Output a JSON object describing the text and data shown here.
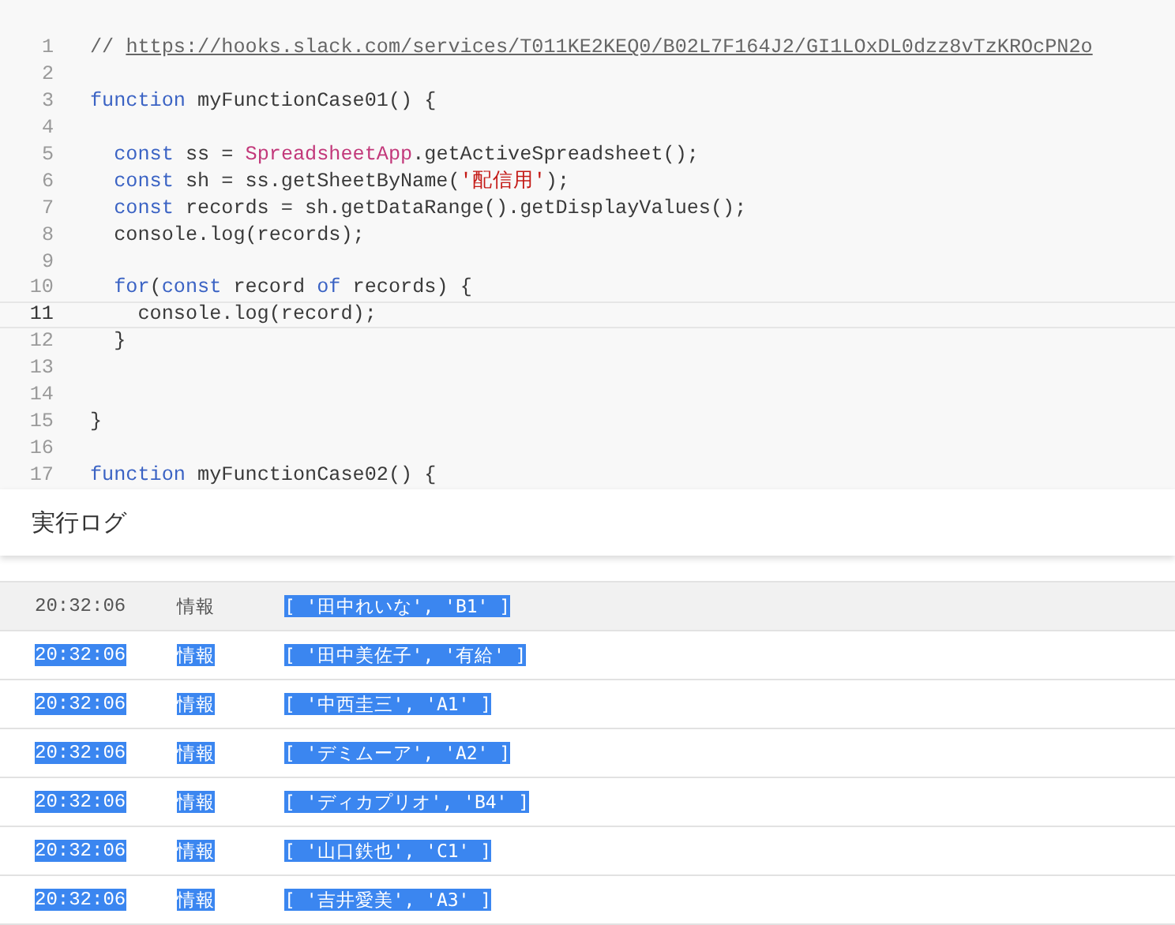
{
  "editor": {
    "lines": [
      {
        "number": "1",
        "current": false,
        "tokens": [
          {
            "kind": "comment",
            "text": "// "
          },
          {
            "kind": "link",
            "text": "https://hooks.slack.com/services/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"
          }
        ]
      },
      {
        "number": "2",
        "current": false
      },
      {
        "number": "3",
        "current": false,
        "tokens": [
          {
            "kind": "keyword",
            "text": "function"
          },
          {
            "kind": "plain",
            "text": " myFunctionCase01() {"
          }
        ]
      },
      {
        "number": "4",
        "current": false
      },
      {
        "number": "5",
        "current": false,
        "tokens": [
          {
            "kind": "keyword",
            "text": "  const"
          },
          {
            "kind": "plain",
            "text": " ss = "
          },
          {
            "kind": "class",
            "text": "SpreadsheetApp"
          },
          {
            "kind": "plain",
            "text": ".getActiveSpreadsheet();"
          }
        ]
      },
      {
        "number": "6",
        "current": false,
        "tokens": [
          {
            "kind": "keyword",
            "text": "  const"
          },
          {
            "kind": "plain",
            "text": " sh = ss.getSheetByName("
          },
          {
            "kind": "string",
            "text": "'配信用'"
          },
          {
            "kind": "plain",
            "text": ");"
          }
        ]
      },
      {
        "number": "7",
        "current": false,
        "tokens": [
          {
            "kind": "keyword",
            "text": "  const"
          },
          {
            "kind": "plain",
            "text": " records = sh.getDataRange().getDisplayValues();"
          }
        ]
      },
      {
        "number": "8",
        "current": false,
        "tokens": [
          {
            "kind": "plain",
            "text": "  console.log(records);"
          }
        ]
      },
      {
        "number": "9",
        "current": false
      },
      {
        "number": "10",
        "current": false,
        "tokens": [
          {
            "kind": "keyword",
            "text": "  for"
          },
          {
            "kind": "plain",
            "text": "("
          },
          {
            "kind": "keyword",
            "text": "const"
          },
          {
            "kind": "plain",
            "text": " record "
          },
          {
            "kind": "keyword",
            "text": "of"
          },
          {
            "kind": "plain",
            "text": " records) {"
          }
        ]
      },
      {
        "number": "11",
        "current": true,
        "tokens": [
          {
            "kind": "plain",
            "text": "    console.log(record);"
          }
        ]
      },
      {
        "number": "12",
        "current": false,
        "tokens": [
          {
            "kind": "plain",
            "text": "  }"
          }
        ]
      },
      {
        "number": "13",
        "current": false
      },
      {
        "number": "14",
        "current": false
      },
      {
        "number": "15",
        "current": false,
        "tokens": [
          {
            "kind": "plain",
            "text": "}"
          }
        ]
      },
      {
        "number": "16",
        "current": false
      },
      {
        "number": "17",
        "current": false,
        "tokens": [
          {
            "kind": "keyword",
            "text": "function"
          },
          {
            "kind": "plain",
            "text": " myFunctionCase02() {"
          }
        ]
      }
    ]
  },
  "log": {
    "title": "実行ログ",
    "rows": [
      {
        "time": "20:32:06",
        "level": "情報",
        "message": "[ '田中れいな', 'B1' ]",
        "hovered": true,
        "time_selected": false,
        "level_selected": false,
        "message_selected": true
      },
      {
        "time": "20:32:06",
        "level": "情報",
        "message": "[ '田中美佐子', '有給' ]",
        "hovered": false,
        "time_selected": true,
        "level_selected": true,
        "message_selected": true
      },
      {
        "time": "20:32:06",
        "level": "情報",
        "message": "[ '中西圭三', 'A1' ]",
        "hovered": false,
        "time_selected": true,
        "level_selected": true,
        "message_selected": true
      },
      {
        "time": "20:32:06",
        "level": "情報",
        "message": "[ 'デミムーア', 'A2' ]",
        "hovered": false,
        "time_selected": true,
        "level_selected": true,
        "message_selected": true
      },
      {
        "time": "20:32:06",
        "level": "情報",
        "message": "[ 'ディカプリオ', 'B4' ]",
        "hovered": false,
        "time_selected": true,
        "level_selected": true,
        "message_selected": true
      },
      {
        "time": "20:32:06",
        "level": "情報",
        "message": "[ '山口鉄也', 'C1' ]",
        "hovered": false,
        "time_selected": true,
        "level_selected": true,
        "message_selected": true
      },
      {
        "time": "20:32:06",
        "level": "情報",
        "message": "[ '吉井愛美', 'A3' ]",
        "hovered": false,
        "time_selected": true,
        "level_selected": true,
        "message_selected": true
      }
    ]
  }
}
